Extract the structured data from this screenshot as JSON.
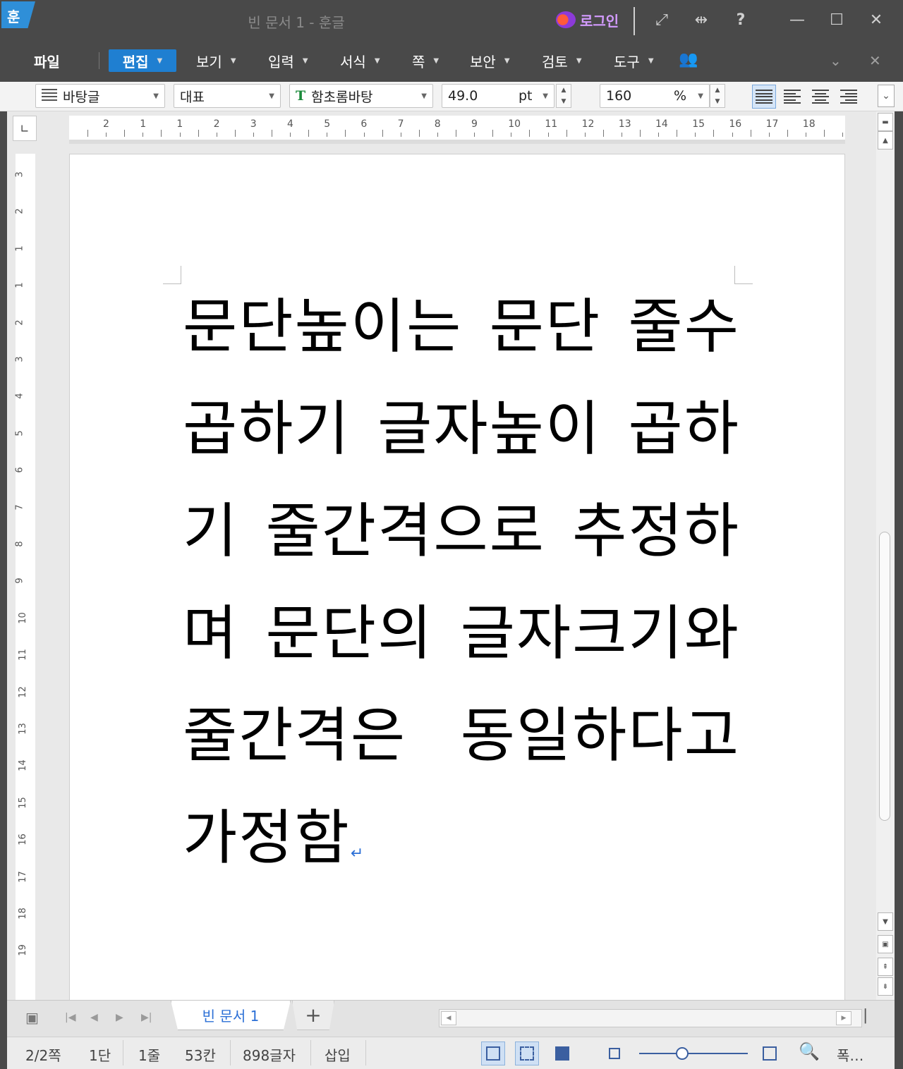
{
  "window": {
    "app_logo": "훈",
    "title": "빈 문서 1 - 훈글",
    "login_label": "로그인",
    "help_label": "?"
  },
  "menu": {
    "file": "파일",
    "items": [
      "편집",
      "보기",
      "입력",
      "서식",
      "쪽",
      "보안",
      "검토",
      "도구"
    ]
  },
  "toolbar": {
    "style_name": "바탕글",
    "language": "대표",
    "font_name": "함초롬바탕",
    "font_size": "49.0",
    "font_size_unit": "pt",
    "line_spacing": "160",
    "line_spacing_unit": "%"
  },
  "ruler": {
    "horizontal": [
      "2",
      "1",
      "1",
      "2",
      "3",
      "4",
      "5",
      "6",
      "7",
      "8",
      "9",
      "10",
      "11",
      "12",
      "13",
      "14",
      "15",
      "16",
      "17",
      "18"
    ],
    "vertical": [
      "3",
      "2",
      "1",
      "1",
      "2",
      "3",
      "4",
      "5",
      "6",
      "7",
      "8",
      "9",
      "10",
      "11",
      "12",
      "13",
      "14",
      "15",
      "16",
      "17",
      "18",
      "19"
    ]
  },
  "document": {
    "text": "문단높이는 문단 줄수 곱하기 글자높이 곱하기 줄간격으로 추정하며 문단의 글자크기와 줄간격은 동일하다고 가정함",
    "paragraph_mark": "↵"
  },
  "tabs": {
    "active_tab": "빈 문서 1",
    "add_label": "+"
  },
  "status": {
    "page": "2/2쪽",
    "column": "1단",
    "line": "1줄",
    "char_pos": "53칸",
    "char_count": "898글자",
    "mode": "삽입",
    "zoom_label": "폭…"
  },
  "colors": {
    "accent": "#1f7fd1",
    "chrome": "#494949",
    "tab_text": "#2b6fd6"
  }
}
